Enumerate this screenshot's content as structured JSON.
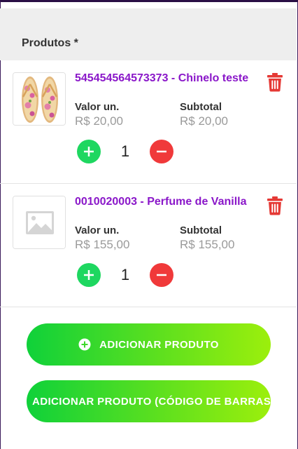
{
  "section": {
    "title": "Produtos *"
  },
  "items": [
    {
      "title": "545454564573373 - Chinelo teste",
      "unit_label": "Valor un.",
      "unit_value": "R$ 20,00",
      "subtotal_label": "Subtotal",
      "subtotal_value": "R$ 20,00",
      "quantity": "1",
      "image": "flip-flop-product-photo"
    },
    {
      "title": "0010020003 - Perfume de Vanilla",
      "unit_label": "Valor un.",
      "unit_value": "R$ 155,00",
      "subtotal_label": "Subtotal",
      "subtotal_value": "R$ 155,00",
      "quantity": "1",
      "image": "image-placeholder-icon"
    }
  ],
  "actions": {
    "add_product": "ADICIONAR PRODUTO",
    "add_product_barcode": "ADICIONAR PRODUTO (CÓDIGO DE BARRAS)"
  },
  "colors": {
    "accent_purple": "#8a17c9",
    "plus_green": "#1ed760",
    "minus_red": "#f0393a",
    "trash_red": "#e53935",
    "button_gradient_start": "#0fd13a",
    "button_gradient_end": "#9cef0c"
  }
}
